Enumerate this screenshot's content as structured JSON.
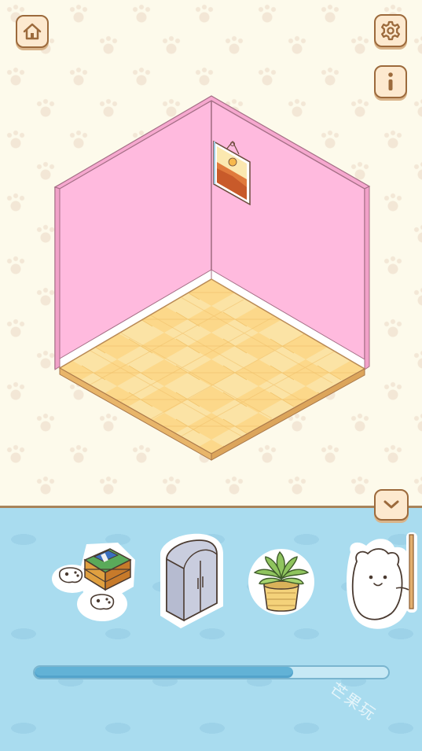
{
  "buttons": [
    {
      "name": "home-button",
      "icon": "home-icon"
    },
    {
      "name": "settings-button",
      "icon": "gear-icon"
    },
    {
      "name": "info-button",
      "icon": "info-icon"
    },
    {
      "name": "collapse-button",
      "icon": "chevron-down-icon"
    }
  ],
  "room": {
    "wall_color": "#ffbade",
    "floor_color": "#fcd88a",
    "wall_decor": "sunset-painting"
  },
  "inventory": {
    "items": [
      {
        "name": "game-console-item",
        "icon": "game-console-icon"
      },
      {
        "name": "wardrobe-item",
        "icon": "wardrobe-icon"
      },
      {
        "name": "potted-plant-item",
        "icon": "potted-plant-icon"
      },
      {
        "name": "bear-mirror-item",
        "icon": "bear-mirror-icon"
      }
    ]
  },
  "progress": {
    "fraction": 0.73
  },
  "watermark": "芒果玩",
  "colors": {
    "bg": "#fdfaeb",
    "panel": "#a9dcef",
    "button_fill": "#fde9cf",
    "button_border": "#9c6a3c",
    "progress_fill": "#62b2d6"
  }
}
